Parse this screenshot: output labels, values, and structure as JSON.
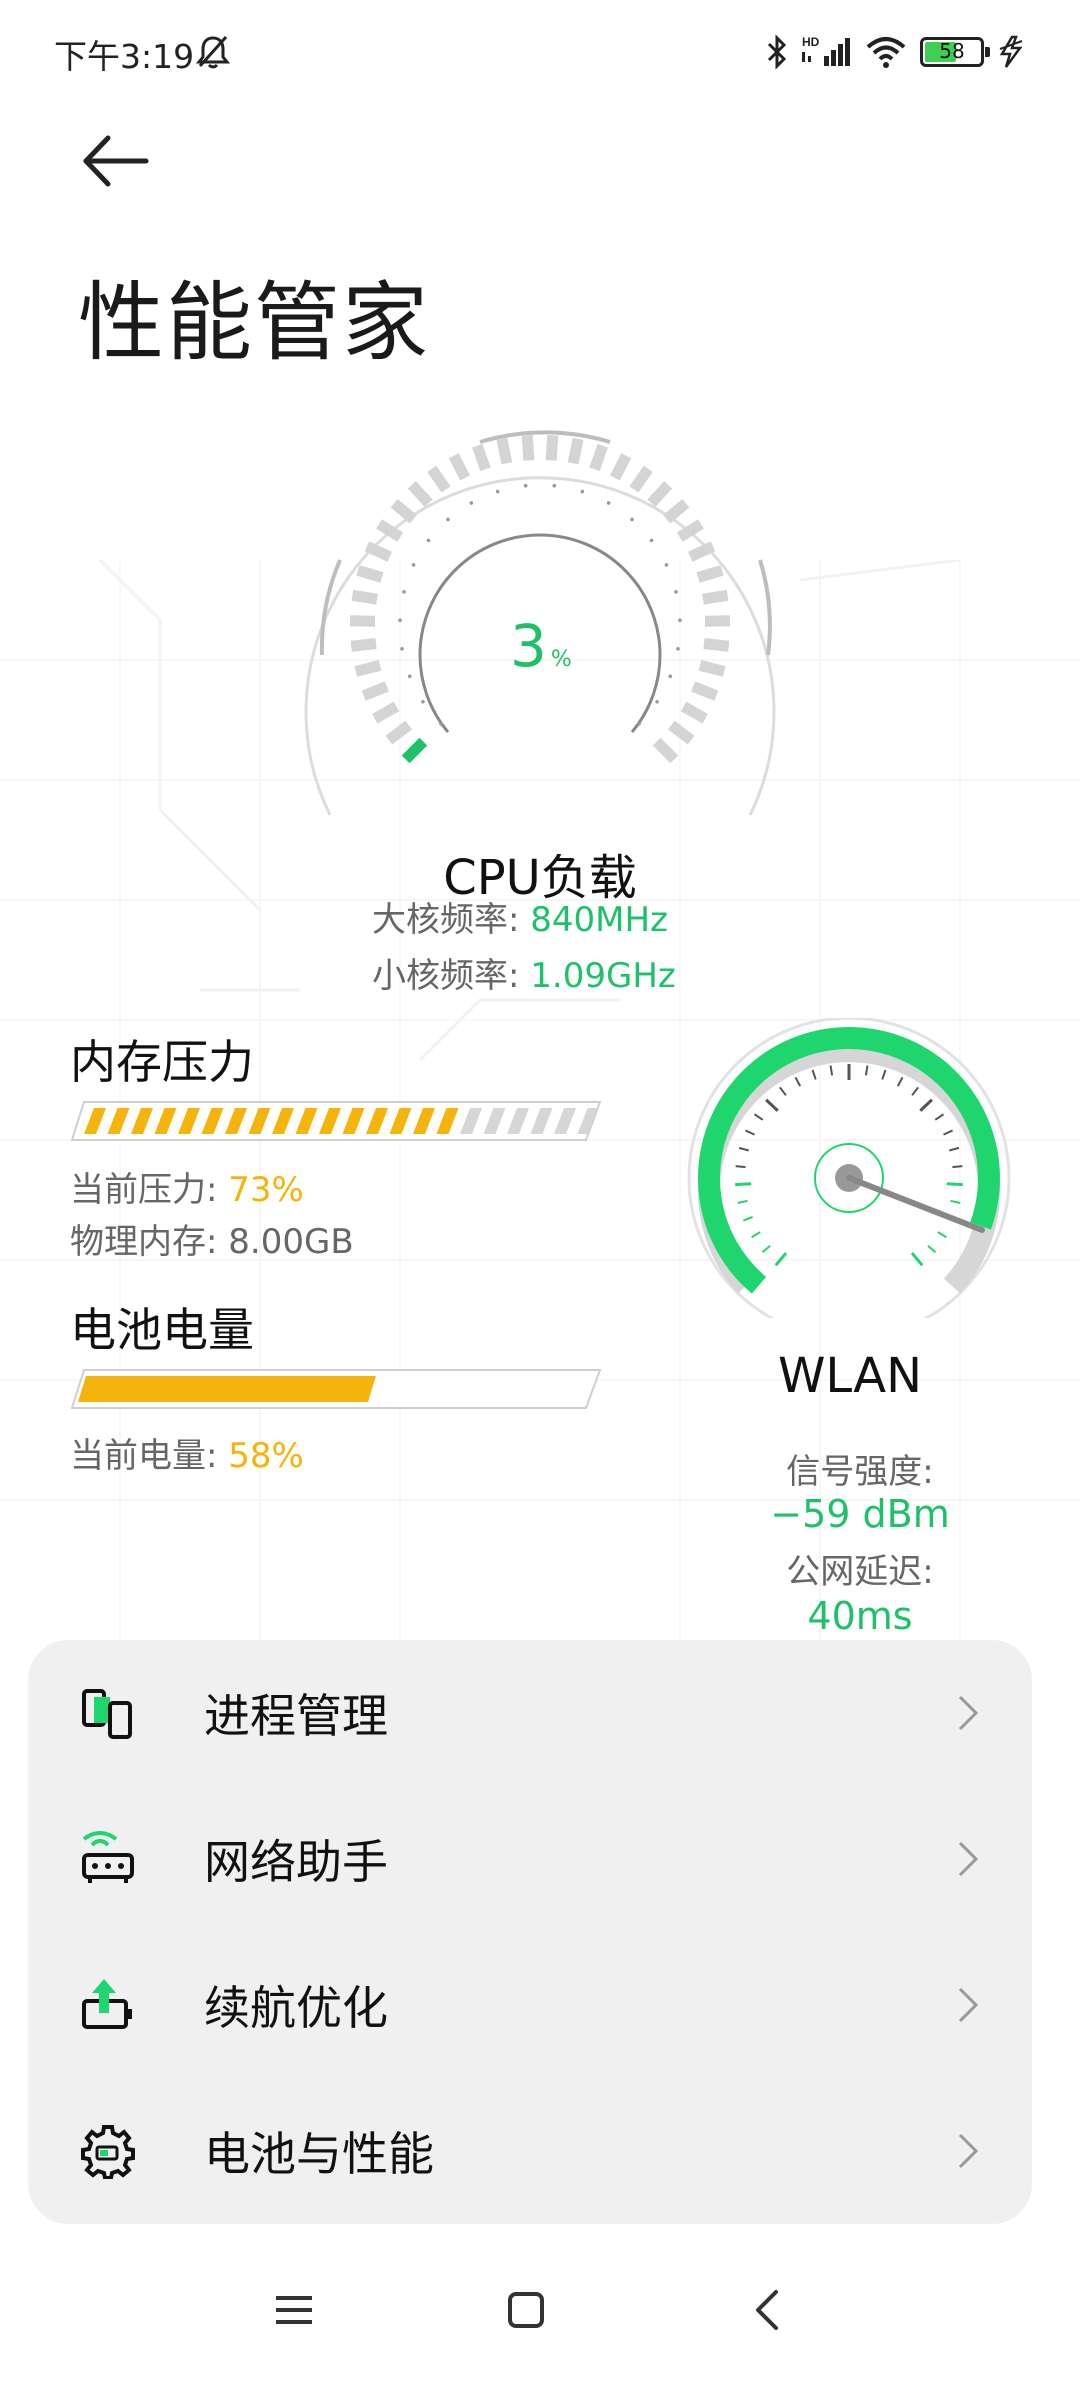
{
  "status": {
    "time": "下午3:19",
    "battery_level": "58",
    "battery_fraction": 0.58,
    "icons": [
      "bell-muted-icon",
      "bluetooth-icon",
      "hd-signal-icon",
      "wifi-icon",
      "battery-icon",
      "charging-bolt-icon"
    ]
  },
  "header": {
    "back_icon": "arrow-left-icon",
    "title": "性能管家"
  },
  "cpu": {
    "load_value": "3",
    "load_unit": "%",
    "load_fraction": 0.03,
    "title": "CPU负载",
    "big_core_label": "大核频率:",
    "big_core_value": "840MHz",
    "little_core_label": "小核频率:",
    "little_core_value": "1.09GHz"
  },
  "memory": {
    "title": "内存压力",
    "pressure_label": "当前压力:",
    "pressure_value": "73%",
    "pressure_fraction": 0.73,
    "physical_label": "物理内存:",
    "physical_value": "8.00GB"
  },
  "battery": {
    "title": "电池电量",
    "level_label": "当前电量:",
    "level_value": "58%",
    "level_fraction": 0.58
  },
  "wlan": {
    "title": "WLAN",
    "signal_label": "信号强度:",
    "signal_value": "−59 dBm",
    "latency_label": "公网延迟:",
    "latency_value": "40ms",
    "accent": "#1fd66e"
  },
  "menu": {
    "items": [
      {
        "label": "进程管理",
        "icon": "process-manager-icon"
      },
      {
        "label": "网络助手",
        "icon": "router-icon"
      },
      {
        "label": "续航优化",
        "icon": "battery-upgrade-icon"
      },
      {
        "label": "电池与性能",
        "icon": "gear-battery-icon"
      }
    ]
  },
  "navbar": {
    "icons": [
      "menu-icon",
      "home-icon",
      "back-icon"
    ]
  },
  "colors": {
    "green": "#1fc168",
    "yellow": "#f5b40c",
    "card_bg": "#f0f0f0"
  }
}
